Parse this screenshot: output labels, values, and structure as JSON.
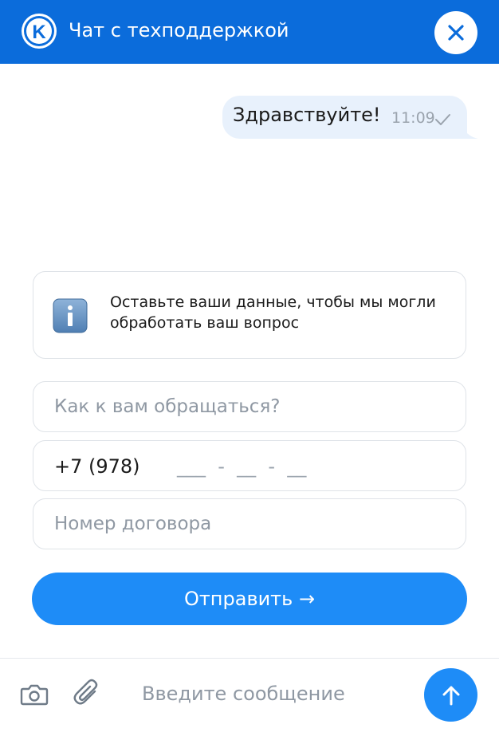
{
  "header": {
    "logo_letter": "K",
    "title": "Чат с техподдержкой",
    "close_icon": "close-icon"
  },
  "messages": [
    {
      "text": "Здравствуйте!",
      "time": "11:09",
      "status_icon": "check-icon"
    }
  ],
  "info": {
    "icon": "info-icon",
    "text": "Оставьте ваши данные, чтобы мы могли обработать ваш вопрос"
  },
  "form": {
    "name_placeholder": "Как к вам обращаться?",
    "phone_prefix": "+7 (978)",
    "phone_mask": "___  -  __  -  __",
    "contract_placeholder": "Номер договора",
    "submit_label": "Отправить →"
  },
  "composer": {
    "camera_icon": "camera-icon",
    "attach_icon": "paperclip-icon",
    "placeholder": "Введите сообщение",
    "send_icon": "arrow-up-icon"
  },
  "colors": {
    "header_bg": "#0b6cdb",
    "accent": "#1e8cf7",
    "bubble_bg": "#e8f1fc"
  }
}
